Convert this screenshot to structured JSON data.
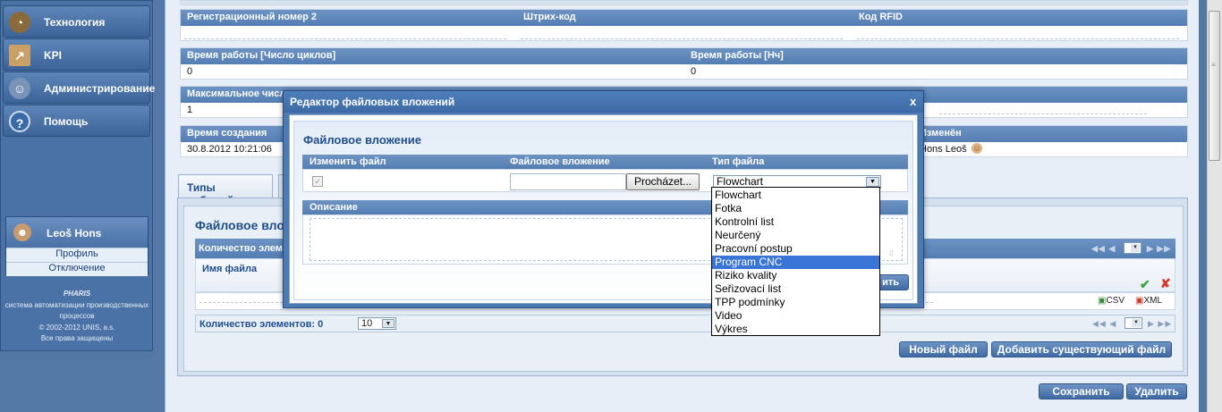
{
  "sidebar": {
    "items": [
      {
        "label": "Технология",
        "icon": "gauge-icon"
      },
      {
        "label": "KPI",
        "icon": "chart-icon"
      },
      {
        "label": "Администрирование",
        "icon": "users-icon"
      },
      {
        "label": "Помощь",
        "icon": "help-icon"
      }
    ],
    "user": {
      "name": "Leoš  Hons",
      "profile_link": "Профиль",
      "logout_link": "Отключение"
    },
    "footer": {
      "brand": "PHARIS",
      "tagline": "система автоматизации производственных процессов",
      "copyright": "© 2002-2012 UNIS, a.s.",
      "rights": "Все права защищены"
    }
  },
  "record": {
    "row1": {
      "reg_number_label": "Регистрационный номер 2",
      "barcode_label": "Штрих-код",
      "rfid_label": "Код RFID"
    },
    "row2": {
      "runtime_cycles_label": "Время работы [Число циклов]",
      "runtime_cycles_value": "0",
      "runtime_hours_label": "Время работы [Нч]",
      "runtime_hours_value": "0"
    },
    "row3": {
      "max_label": "Максимальное числ",
      "max_value": "1"
    },
    "row4": {
      "created_label": "Время создания",
      "created_value": "30.8.2012 10:21:06",
      "changed_label": "Изменён",
      "changed_value": "Hons Leoš"
    }
  },
  "tabs": [
    {
      "label": "Типы событий"
    }
  ],
  "attachments_panel": {
    "title": "Файловое влож",
    "count_label": "Количество элеме",
    "file_name_header": "Имя файла",
    "footer_count": "Количество элементов: 0",
    "page_size": "10",
    "export_csv": "CSV",
    "export_xml": "XML",
    "new_file_button": "Новый файл",
    "add_existing_button": "Добавить существующий файл"
  },
  "bottom_buttons": {
    "save": "Сохранить",
    "delete": "Удалить"
  },
  "dialog": {
    "title": "Редактор файловых вложений",
    "close": "x",
    "section_title": "Файловое вложение",
    "columns": {
      "change_file": "Изменить файл",
      "attachment": "Файловое вложение",
      "file_type": "Тип файла"
    },
    "browse_button": "Procházet...",
    "file_type_value": "Flowchart",
    "description_label": "Описание",
    "save_button_partial": "ить"
  },
  "file_type_options": [
    {
      "label": "Flowchart",
      "selected": false
    },
    {
      "label": "Fotka",
      "selected": false
    },
    {
      "label": "Kontrolní list",
      "selected": false
    },
    {
      "label": "Neurčený",
      "selected": false
    },
    {
      "label": "Pracovní postup",
      "selected": false
    },
    {
      "label": "Program CNC",
      "selected": true
    },
    {
      "label": "Riziko kvality",
      "selected": false
    },
    {
      "label": "Seřizovací list",
      "selected": false
    },
    {
      "label": "TPP podmínky",
      "selected": false
    },
    {
      "label": "Video",
      "selected": false
    },
    {
      "label": "Výkres",
      "selected": false
    }
  ],
  "colors": {
    "accent": "#4d7ab1",
    "header_blue": "#5d85b8",
    "highlight": "#3875d7"
  }
}
